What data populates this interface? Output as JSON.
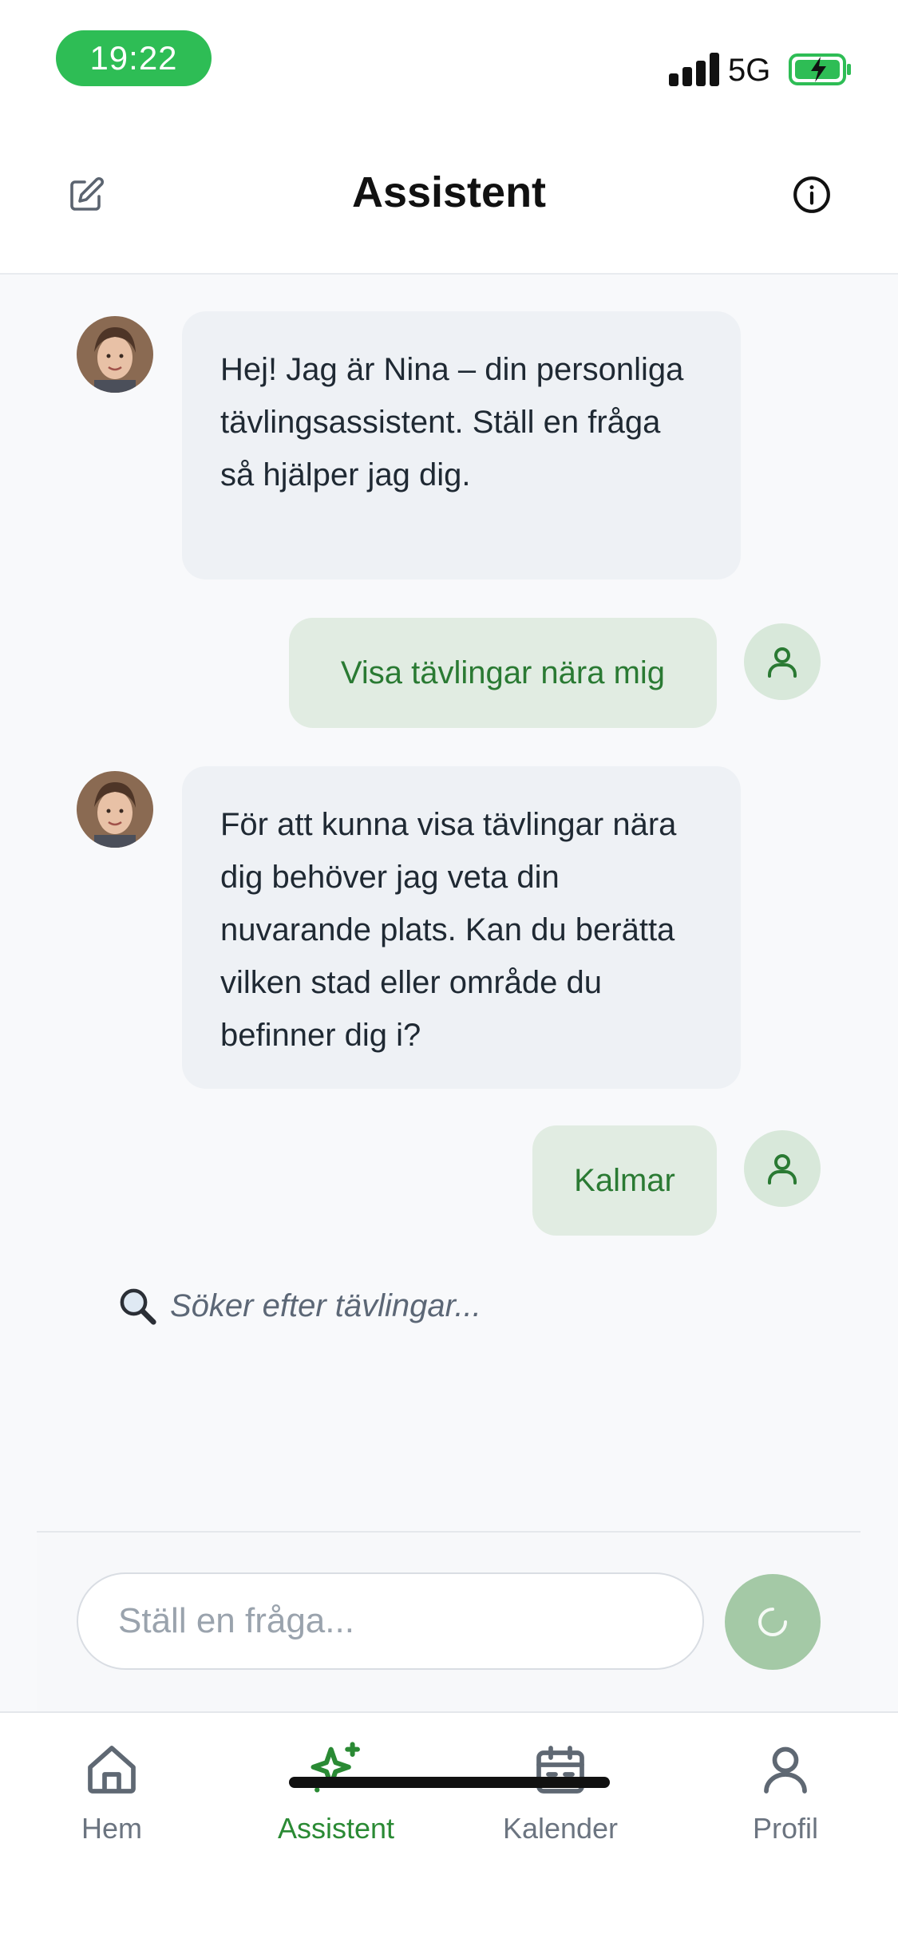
{
  "status_bar": {
    "time": "19:22",
    "network": "5G",
    "battery_color": "#2ebd55"
  },
  "header": {
    "title": "Assistent",
    "left_icon": "edit-icon",
    "right_icon": "info-icon"
  },
  "messages": [
    {
      "role": "assistant",
      "text": "Hej! Jag är Nina – din personliga tävlingsassistent. Ställ en fråga så hjälper jag dig."
    },
    {
      "role": "user",
      "text": "Visa tävlingar nära mig"
    },
    {
      "role": "assistant",
      "text": "För att kunna visa tävlingar nära dig behöver jag veta din nuvarande plats. Kan du berätta vilken stad eller område du befinner dig i?"
    },
    {
      "role": "user",
      "text": "Kalmar"
    }
  ],
  "status_message": {
    "icon": "magnifier-icon",
    "text": "Söker efter tävlingar..."
  },
  "composer": {
    "placeholder": "Ställ en fråga...",
    "send_icon": "loading-spinner-icon"
  },
  "bottom_nav": {
    "items": [
      {
        "label": "Hem",
        "icon": "home-icon",
        "active": false
      },
      {
        "label": "Assistent",
        "icon": "sparkles-icon",
        "active": true
      },
      {
        "label": "Kalender",
        "icon": "calendar-icon",
        "active": false
      },
      {
        "label": "Profil",
        "icon": "profile-icon",
        "active": false
      }
    ]
  },
  "colors": {
    "accent": "#2a8a34",
    "user_bubble": "#e1ece2",
    "bot_bubble": "#eef1f5"
  }
}
